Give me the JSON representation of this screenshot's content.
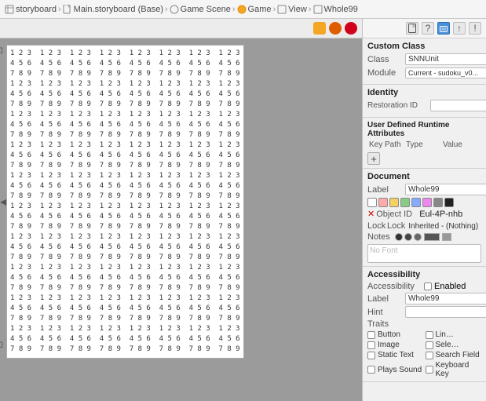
{
  "breadcrumb": {
    "items": [
      {
        "label": "storyboard",
        "icon": "storyboard-icon"
      },
      {
        "label": "Main.storyboard (Base)",
        "icon": "file-icon"
      },
      {
        "label": "Game Scene",
        "icon": "scene-icon"
      },
      {
        "label": "Game",
        "icon": "game-icon"
      },
      {
        "label": "View",
        "icon": "view-icon"
      },
      {
        "label": "Whole99",
        "icon": "view-icon"
      }
    ]
  },
  "toolbar": {
    "icons": [
      {
        "label": "yellow-circle",
        "color": "#f5a623"
      },
      {
        "label": "orange-circle",
        "color": "#e05c00"
      },
      {
        "label": "red-circle",
        "color": "#d0021b"
      }
    ]
  },
  "grid": {
    "rows": [
      "1 2 3  1 2 3  1 2 3  1 2 3  1 2 3  1 2 3  1 2 3  1 2 3",
      "4 5 6  4 5 6  4 5 6  4 5 6  4 5 6  4 5 6  4 5 6  4 5 6",
      "7 8 9  7 8 9  7 8 9  7 8 9  7 8 9  7 8 9  7 8 9  7 8 9",
      "1 2 3  1 2 3  1 2 3  1 2 3  1 2 3  1 2 3  1 2 3  1 2 3",
      "4 5 6  4 5 6  4 5 6  4 5 6  4 5 6  4 5 6  4 5 6  4 5 6",
      "7 8 9  7 8 9  7 8 9  7 8 9  7 8 9  7 8 9  7 8 9  7 8 9",
      "1 2 3  1 2 3  1 2 3  1 2 3  1 2 3  1 2 3  1 2 3  1 2 3",
      "4 5 6  4 5 6  4 5 6  4 5 6  4 5 6  4 5 6  4 5 6  4 5 6",
      "7 8 9  7 8 9  7 8 9  7 8 9  7 8 9  7 8 9  7 8 9  7 8 9",
      "1 2 3  1 2 3  1 2 3  1 2 3  1 2 3  1 2 3  1 2 3  1 2 3",
      "4 5 6  4 5 6  4 5 6  4 5 6  4 5 6  4 5 6  4 5 6  4 5 6",
      "7 8 9  7 8 9  7 8 9  7 8 9  7 8 9  7 8 9  7 8 9  7 8 9",
      "1 2 3  1 2 3  1 2 3  1 2 3  1 2 3  1 2 3  1 2 3  1 2 3",
      "4 5 6  4 5 6  4 5 6  4 5 6  4 5 6  4 5 6  4 5 6  4 5 6",
      "7 8 9  7 8 9  7 8 9  7 8 9  7 8 9  7 8 9  7 8 9  7 8 9",
      "1 2 3  1 2 3  1 2 3  1 2 3  1 2 3  1 2 3  1 2 3  1 2 3",
      "4 5 6  4 5 6  4 5 6  4 5 6  4 5 6  4 5 6  4 5 6  4 5 6",
      "7 8 9  7 8 9  7 8 9  7 8 9  7 8 9  7 8 9  7 8 9  7 8 9",
      "1 2 3  1 2 3  1 2 3  1 2 3  1 2 3  1 2 3  1 2 3  1 2 3",
      "4 5 6  4 5 6  4 5 6  4 5 6  4 5 6  4 5 6  4 5 6  4 5 6",
      "7 8 9  7 8 9  7 8 9  7 8 9  7 8 9  7 8 9  7 8 9  7 8 9",
      "1 2 3  1 2 3  1 2 3  1 2 3  1 2 3  1 2 3  1 2 3  1 2 3",
      "4 5 6  4 5 6  4 5 6  4 5 6  4 5 6  4 5 6  4 5 6  4 5 6",
      "7 8 9  7 8 9  7 8 9  7 8 9  7 8 9  7 8 9  7 8 9  7 8 9",
      "1 2 3  1 2 3  1 2 3  1 2 3  1 2 3  1 2 3  1 2 3  1 2 3",
      "4 5 6  4 5 6  4 5 6  4 5 6  4 5 6  4 5 6  4 5 6  4 5 6",
      "7 8 9  7 8 9  7 8 9  7 8 9  7 8 9  7 8 9  7 8 9  7 8 9",
      "1 2 3  1 2 3  1 2 3  1 2 3  1 2 3  1 2 3  1 2 3  1 2 3",
      "4 5 6  4 5 6  4 5 6  4 5 6  4 5 6  4 5 6  4 5 6  4 5 6",
      "7 8 9  7 8 9  7 8 9  7 8 9  7 8 9  7 8 9  7 8 9  7 8 9"
    ]
  },
  "panel_icons": [
    {
      "label": "file-icon",
      "symbol": "📄"
    },
    {
      "label": "question-icon",
      "symbol": "?"
    },
    {
      "label": "identity-icon",
      "symbol": "🆔"
    },
    {
      "label": "arrow-icon",
      "symbol": "↑"
    },
    {
      "label": "warning-icon",
      "symbol": "!"
    }
  ],
  "custom_class": {
    "section_title": "Custom Class",
    "class_label": "Class",
    "class_value": "SNNUnit",
    "module_label": "Module",
    "module_value": "Current - sudoku_v0..."
  },
  "identity": {
    "section_title": "Identity",
    "restoration_label": "Restoration ID",
    "restoration_value": ""
  },
  "user_defined": {
    "section_title": "User Defined Runtime Attributes",
    "col_key": "Key Path",
    "col_type": "Type",
    "col_value": "Value"
  },
  "document": {
    "section_title": "Document",
    "label_label": "Label",
    "label_value": "Whole99",
    "object_id_label": "Object ID",
    "object_id_value": "Eul-4P-nhb",
    "lock_label": "Lock",
    "lock_value": "Inherited - (Nothing)",
    "notes_label": "Notes",
    "notes_placeholder": "No Font",
    "swatches": [
      "#ffffff",
      "#ffaaaa",
      "#ffdd66",
      "#aaffaa",
      "#aaaaff",
      "#ff88ff",
      "#888888",
      "#000000"
    ]
  },
  "accessibility": {
    "section_title": "Accessibility",
    "accessibility_label": "Accessibility",
    "enabled_label": "Enabled",
    "label_label": "Label",
    "label_value": "Whole99",
    "hint_label": "Hint",
    "hint_value": "",
    "traits_label": "Traits",
    "traits": [
      {
        "label": "Button",
        "checked": false
      },
      {
        "label": "Link",
        "checked": false
      },
      {
        "label": "Image",
        "checked": false
      },
      {
        "label": "Selected",
        "checked": false
      },
      {
        "label": "Static Text",
        "checked": false
      },
      {
        "label": "Search Field",
        "checked": false
      },
      {
        "label": "Plays Sound",
        "checked": false
      },
      {
        "label": "Keyboard Key",
        "checked": false
      }
    ]
  }
}
